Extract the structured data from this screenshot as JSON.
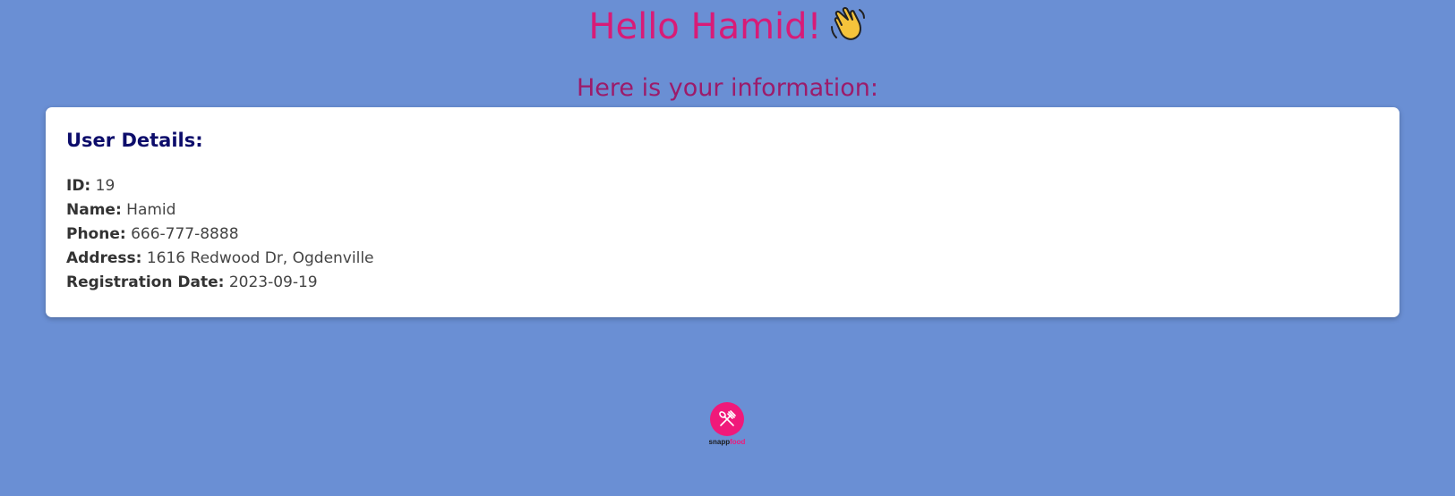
{
  "greeting": {
    "text": "Hello Hamid!",
    "emoji_icon": "waving-hand-icon"
  },
  "subheading": "Here is your information:",
  "user_card": {
    "title": "User Details:",
    "fields": [
      {
        "label": "ID:",
        "value": "19"
      },
      {
        "label": "Name:",
        "value": "Hamid"
      },
      {
        "label": "Phone:",
        "value": "666-777-8888"
      },
      {
        "label": "Address:",
        "value": "1616 Redwood Dr, Ogdenville"
      },
      {
        "label": "Registration Date:",
        "value": "2023-09-19"
      }
    ]
  },
  "logo": {
    "icon": "fork-and-knife-icon",
    "text_part1": "snapp",
    "text_part2": "food"
  },
  "colors": {
    "background": "#6a8fd4",
    "greeting": "#d81b77",
    "subheading": "#9c1b6a",
    "card_title": "#0d0d6b",
    "brand": "#f0197a"
  }
}
